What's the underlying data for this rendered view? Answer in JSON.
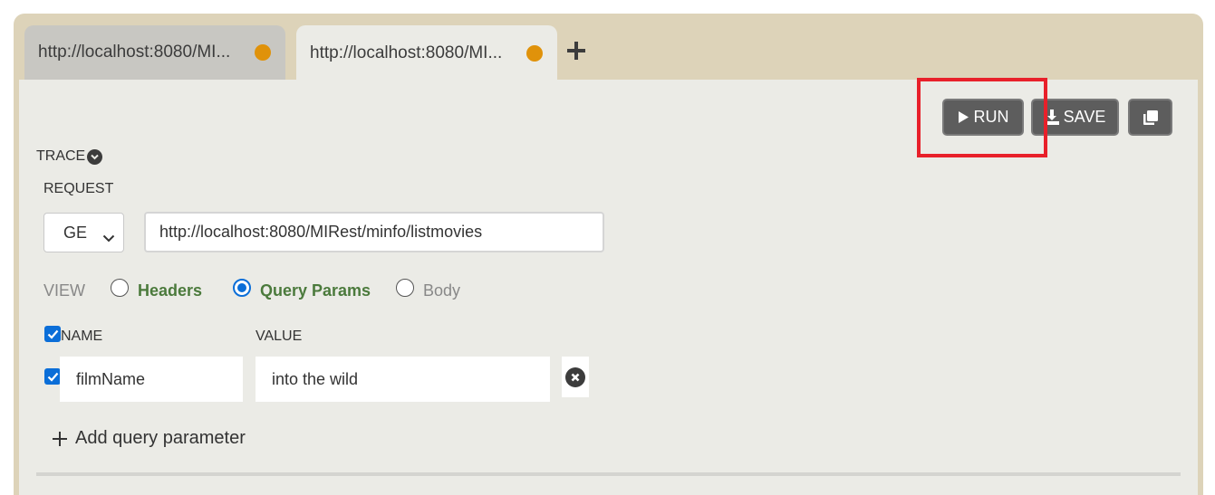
{
  "tabs": [
    {
      "title": "http://localhost:8080/MI...",
      "active": false,
      "status_color": "#e0920a"
    },
    {
      "title": "http://localhost:8080/MI...",
      "active": true,
      "status_color": "#e0920a"
    }
  ],
  "toolbar": {
    "run_label": "RUN",
    "save_label": "SAVE",
    "run_icon": "play-icon",
    "save_icon": "download-icon",
    "copy_icon": "copy-icon"
  },
  "trace": {
    "label": "TRACE",
    "icon": "chevron-down-circle-icon"
  },
  "request": {
    "label": "REQUEST",
    "method": "GE",
    "url": "http://localhost:8080/MIRest/minfo/listmovies"
  },
  "view": {
    "label": "VIEW",
    "options": [
      {
        "label": "Headers",
        "checked": false
      },
      {
        "label": "Query Params",
        "checked": true
      },
      {
        "label": "Body",
        "checked": false
      }
    ]
  },
  "params": {
    "columns": {
      "name": "NAME",
      "value": "VALUE"
    },
    "rows": [
      {
        "enabled": true,
        "name": "filmName",
        "value": "into the wild"
      }
    ],
    "add_label": "Add query parameter"
  },
  "colors": {
    "accent": "#0b6ed8",
    "highlight": "#e8202a",
    "button_bg": "#5d5d5d",
    "tab_status": "#e0920a",
    "frame_bg": "#ddd3b9"
  }
}
